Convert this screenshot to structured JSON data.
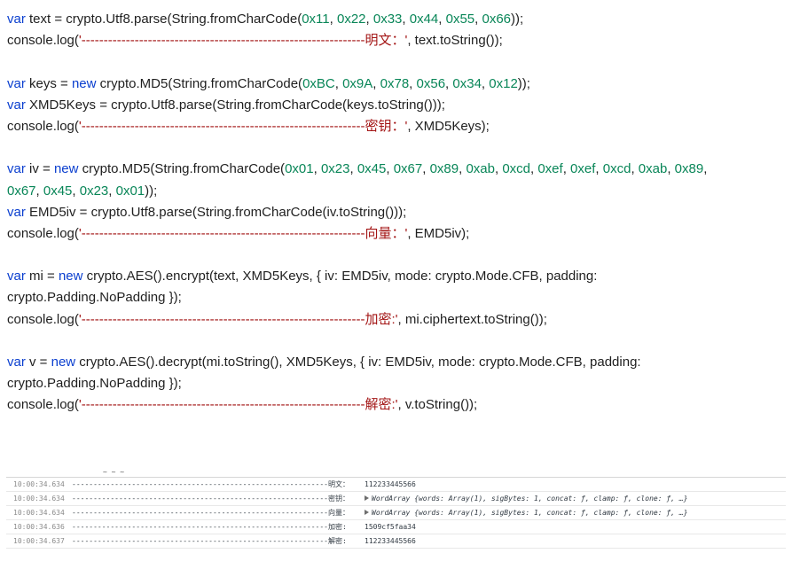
{
  "code_lines": {
    "l1": {
      "a": "var",
      "b": " text = crypto.Utf8.parse(String.fromCharCode(",
      "n1": "0x11",
      "n2": "0x22",
      "n3": "0x33",
      "n4": "0x44",
      "n5": "0x55",
      "n6": "0x66",
      "end": "));"
    },
    "l2": {
      "a": "console.log(",
      "s": "'----------------------------------------------------------------明文：'",
      "b": ", text.toString());"
    },
    "l3": {
      "a": "var",
      "b": " keys = ",
      "c": "new",
      "d": " crypto.MD5(String.fromCharCode(",
      "n1": "0xBC",
      "n2": "0x9A",
      "n3": "0x78",
      "n4": "0x56",
      "n5": "0x34",
      "n6": "0x12",
      "end": "));"
    },
    "l4": {
      "a": "var",
      "b": " XMD5Keys = crypto.Utf8.parse(String.fromCharCode(keys.toString()));"
    },
    "l5": {
      "a": "console.log(",
      "s": "'----------------------------------------------------------------密钥：'",
      "b": ", XMD5Keys);"
    },
    "l6": {
      "a": "var",
      "b": " iv = ",
      "c": "new",
      "d": " crypto.MD5(String.fromCharCode(",
      "n": [
        "0x01",
        "0x23",
        "0x45",
        "0x67",
        "0x89",
        "0xab",
        "0xcd",
        "0xef",
        "0xef",
        "0xcd",
        "0xab",
        "0x89"
      ]
    },
    "l7": {
      "n": [
        "0x67",
        "0x45",
        "0x23",
        "0x01"
      ],
      "end": "));"
    },
    "l8": {
      "a": "var",
      "b": " EMD5iv = crypto.Utf8.parse(String.fromCharCode(iv.toString()));"
    },
    "l9": {
      "a": "console.log(",
      "s": "'----------------------------------------------------------------向量：'",
      "b": ", EMD5iv);"
    },
    "l10": {
      "a": "var",
      "b": " mi = ",
      "c": "new",
      "d": " crypto.AES().encrypt(text, XMD5Keys, { iv: EMD5iv, mode: crypto.Mode.CFB, padding:"
    },
    "l11": {
      "b": "crypto.Padding.NoPadding });"
    },
    "l12": {
      "a": "console.log(",
      "s": "'----------------------------------------------------------------加密:'",
      "b": ", mi.ciphertext.toString());"
    },
    "l13": {
      "a": "var",
      "b": " v = ",
      "c": "new",
      "d": " crypto.AES().decrypt(mi.toString(), XMD5Keys, { iv: EMD5iv, mode: crypto.Mode.CFB, padding:"
    },
    "l14": {
      "b": "crypto.Padding.NoPadding });"
    },
    "l15": {
      "a": "console.log(",
      "s": "'----------------------------------------------------------------解密:'",
      "b": ", v.toString());"
    }
  },
  "console_cut_text": "~ ~ ~",
  "console": [
    {
      "time": "10:00:34.634",
      "msg": "------------------------------------------------------------明文：",
      "value": "112233445566"
    },
    {
      "time": "10:00:34.634",
      "msg": "------------------------------------------------------------密钥：",
      "object": "WordArray {words: Array(1), sigBytes: 1, concat: ƒ, clamp: ƒ, clone: ƒ, …}"
    },
    {
      "time": "10:00:34.634",
      "msg": "------------------------------------------------------------向量：",
      "object": "WordArray {words: Array(1), sigBytes: 1, concat: ƒ, clamp: ƒ, clone: ƒ, …}"
    },
    {
      "time": "10:00:34.636",
      "msg": "------------------------------------------------------------加密:",
      "value": "1509cf5faa34"
    },
    {
      "time": "10:00:34.637",
      "msg": "------------------------------------------------------------解密:",
      "value": "112233445566"
    }
  ],
  "colors": {
    "keyword": "#0b3fcf",
    "number": "#098658",
    "string": "#a31515",
    "text": "#1f1f1f"
  }
}
